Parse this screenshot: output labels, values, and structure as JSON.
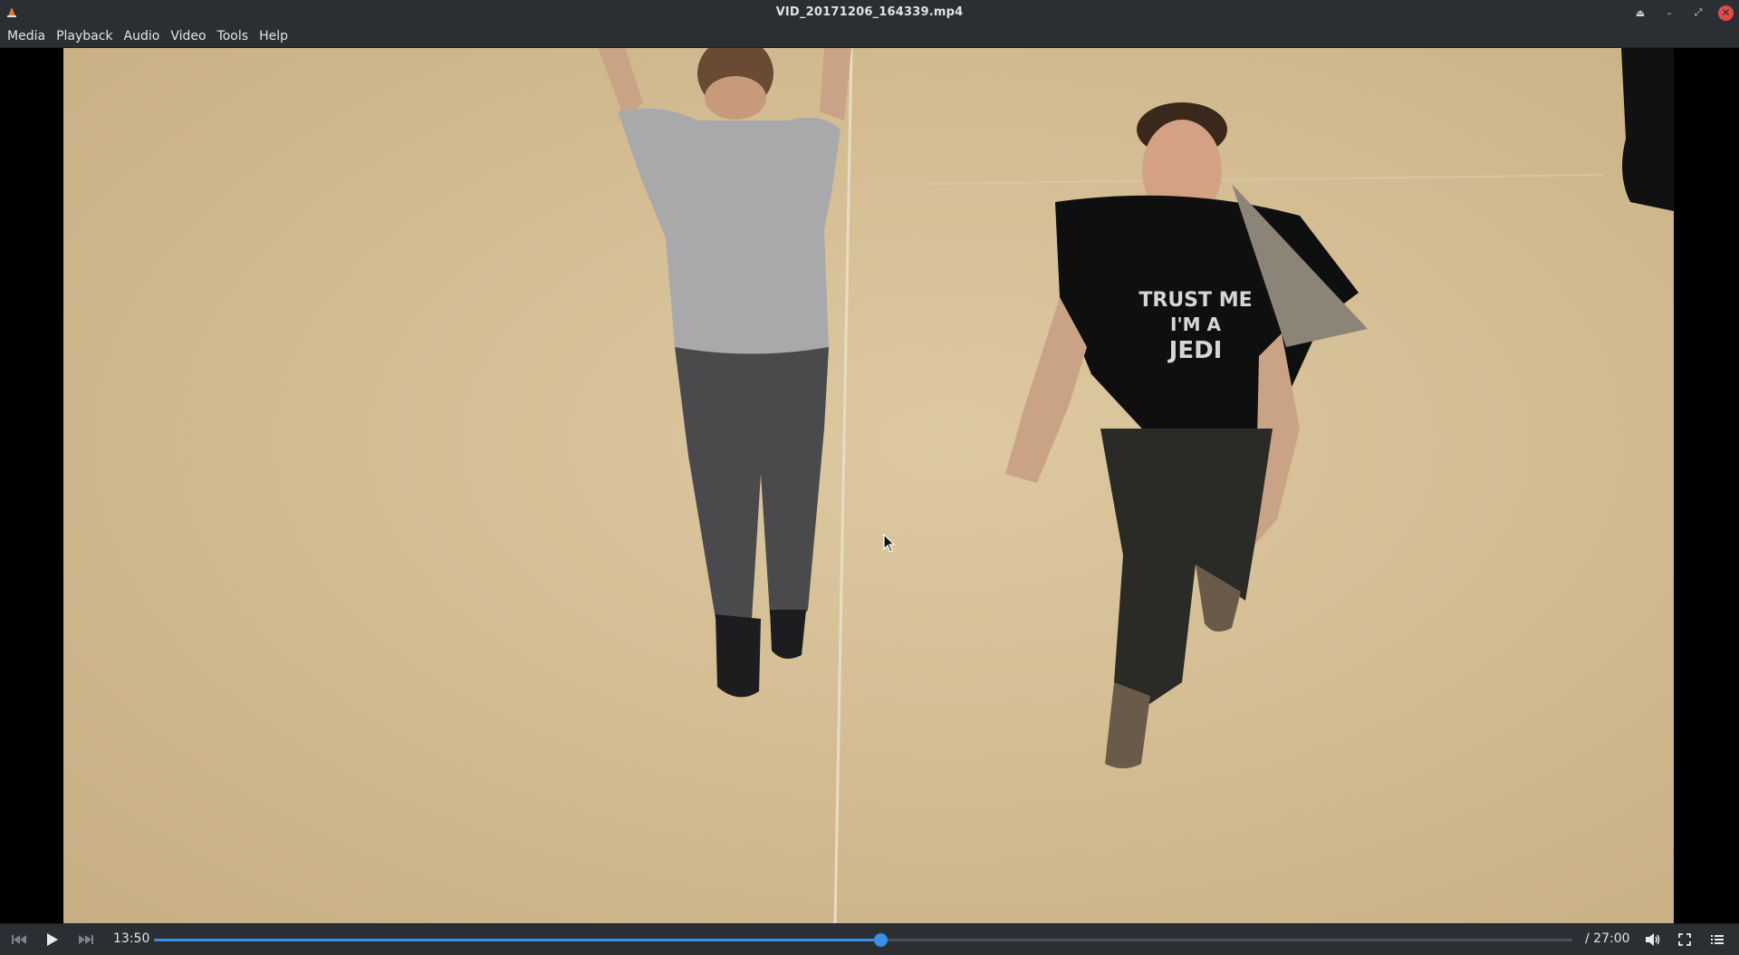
{
  "window": {
    "title": "VID_20171206_164339.mp4",
    "controls": [
      "eject-icon",
      "minimize-icon",
      "restore-icon",
      "close-icon"
    ]
  },
  "menubar": {
    "items": [
      "Media",
      "Playback",
      "Audio",
      "Video",
      "Tools",
      "Help"
    ]
  },
  "video": {
    "shirt_text": [
      "TRUST ME",
      "I'M A",
      "JEDI"
    ]
  },
  "controls": {
    "current_time": "13:50",
    "total_time": "/ 27:00",
    "progress": 0.512,
    "accent_color": "#3d8ee6",
    "buttons": [
      "previous-icon",
      "play-icon",
      "next-icon",
      "volume-icon",
      "fullscreen-icon",
      "playlist-icon"
    ]
  }
}
